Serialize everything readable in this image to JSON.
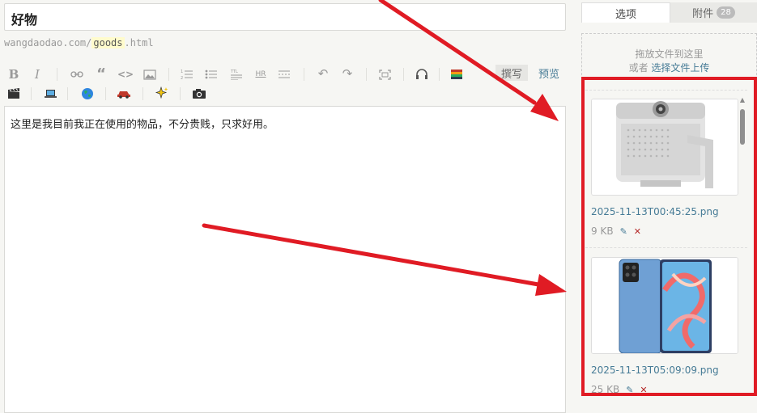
{
  "post": {
    "title": "好物",
    "slug_prefix": "wangdaodao.com/",
    "slug_value": "goods",
    "slug_suffix": ".html",
    "content": "这里是我目前我正在使用的物品，不分贵贱，只求好用。"
  },
  "toolbar": {
    "bold": "B",
    "italic": "I",
    "link": "⊖",
    "quote": "“",
    "code": "<>",
    "image": "▭",
    "ordered_list": "≡",
    "unordered_list": "≡",
    "title": "≡",
    "hr": "HR",
    "more": "≡",
    "undo": "↶",
    "redo": "↷",
    "fullscreen": "⛶",
    "headphones": "🎧",
    "books": "📚",
    "movie": "🎬",
    "laptop": "💻",
    "globe": "🌍",
    "car": "🚗",
    "sparkle": "✨",
    "camera": "📷"
  },
  "modes": {
    "write": "撰写",
    "preview": "预览"
  },
  "sidebar": {
    "tab_options": "选项",
    "tab_attachments": "附件",
    "attachment_count": "28",
    "upload_drag": "拖放文件到这里",
    "upload_or": "或者",
    "upload_select": "选择文件上传"
  },
  "files": [
    {
      "name": "2025-11-13T00:45:25.png",
      "size": "9 KB",
      "thumb": "projector-image"
    },
    {
      "name": "2025-11-13T05:09:09.png",
      "size": "25 KB",
      "thumb": "phone-image"
    }
  ],
  "colors": {
    "accent": "#467b96",
    "annotation_red": "#e01b24",
    "delete_red": "#b52a2a"
  }
}
